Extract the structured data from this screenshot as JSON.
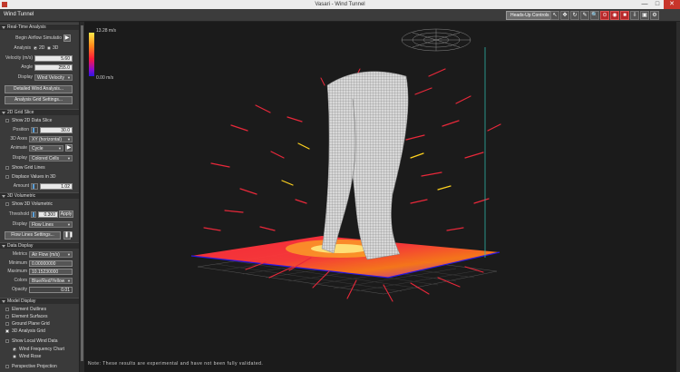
{
  "window": {
    "title": "Vasari - Wind Tunnel",
    "min": "—",
    "max": "□",
    "close": "✕"
  },
  "toolbar": {
    "app_title": "Wind Tunnel",
    "hud_label": "Heads-Up Controls",
    "tool_icons": [
      "↖",
      "✥",
      "↻",
      "✎",
      "🔍",
      "⊙",
      "◉",
      "■",
      "⇩",
      "▣",
      "⚙"
    ]
  },
  "realtime": {
    "section": "Real-Time Analysis",
    "begin_label": "Begin Airflow Simulatio",
    "analysis_label": "Analysis",
    "opt_2d": "2D",
    "opt_3d": "3D",
    "velocity_label": "Velocity (m/s)",
    "velocity_value": "5.60",
    "angle_label": "Angle",
    "angle_value": "255.0",
    "display_label": "Display",
    "display_value": "Wind Velocity",
    "detailed_btn": "Detailed Wind Analysis...",
    "grid_btn": "Analysis Grid Settings..."
  },
  "slice": {
    "section": "2D Grid Slice",
    "show_label": "Show 2D Data Slice",
    "position_label": "Position",
    "position_value": "30.0",
    "axes_label": "3D Axes",
    "axes_value": "XY (horizontal)",
    "animate_label": "Animate",
    "animate_value": "Cycle",
    "display_label": "Display",
    "display_value": "Colored Cells",
    "grid_lines_label": "Show Grid Lines",
    "displace_label": "Displace Values in 3D",
    "amount_label": "Amount",
    "amount_value": "1.02"
  },
  "volumetric": {
    "section": "3D Volumetric",
    "show_label": "Show 3D Volumetric",
    "threshold_label": "Threshold",
    "threshold_value": "0.300",
    "apply_label": "Apply",
    "display_label": "Display",
    "display_value": "Flow Lines",
    "settings_btn": "Flow Lines Settings..."
  },
  "datadisplay": {
    "section": "Data Display",
    "metrics_label": "Metrics",
    "metrics_value": "Air Flow (m/s)",
    "min_label": "Minimum",
    "min_value": "0.00000000",
    "max_label": "Maximum",
    "max_value": "10.15230000",
    "colors_label": "Colors",
    "colors_value": "Blue/Red/Yellow",
    "opacity_label": "Opacity",
    "opacity_value": "0.01"
  },
  "model": {
    "section": "Model Display",
    "outlines": "Element Outlines",
    "surfaces": "Element Surfaces",
    "ground_grid": "Ground Plane Grid",
    "analysis_grid": "3D Analysis Grid",
    "local_wind": "Show Local Wind Data",
    "freq_chart": "Wind Frequency Chart",
    "wind_rose": "Wind Rose",
    "perspective": "Perspective Projection"
  },
  "viewport": {
    "legend_max": "13.28 m/s",
    "legend_min": "0.00 m/s",
    "note": "Note: These results are experimental and have not been fully validated."
  },
  "colors": {
    "accent": "#5a9fd8",
    "stream_red": "#e8283a",
    "stream_yellow": "#ffd21e",
    "plane": "#ff2a3c"
  }
}
